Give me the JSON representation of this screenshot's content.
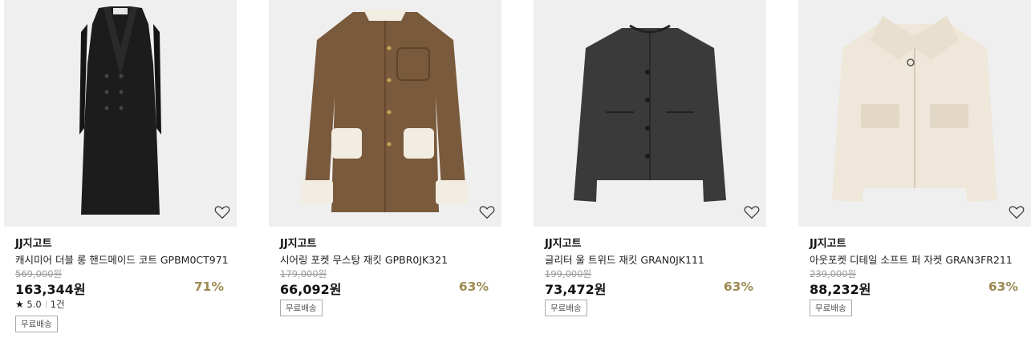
{
  "products": [
    {
      "brand": "JJ지고트",
      "name": "캐시미어 더블 롱 핸드메이드 코트 GPBM0CT971",
      "original_price": "569,000원",
      "price": "163,344원",
      "discount": "71%",
      "rating": "5.0",
      "review_count": "1건",
      "badge": "무료배송",
      "wishlist_icon": "heart-outline-icon",
      "image_colors": {
        "garment": "#1c1c1c",
        "trim": "#111111"
      }
    },
    {
      "brand": "JJ지고트",
      "name": "시어링 포켓 무스탕 재킷 GPBR0JK321",
      "original_price": "179,000원",
      "price": "66,092원",
      "discount": "63%",
      "badge": "무료배송",
      "wishlist_icon": "heart-outline-icon",
      "image_colors": {
        "garment": "#7a5a3c",
        "trim": "#f2ede2"
      }
    },
    {
      "brand": "JJ지고트",
      "name": "글리터 울 트위드 재킷 GRAN0JK111",
      "original_price": "199,000원",
      "price": "73,472원",
      "discount": "63%",
      "badge": "무료배송",
      "wishlist_icon": "heart-outline-icon",
      "image_colors": {
        "garment": "#3a3a3a",
        "trim": "#2a2a2a"
      }
    },
    {
      "brand": "JJ지고트",
      "name": "아웃포켓 디테일 소프트 퍼 자켓 GRAN3FR211",
      "original_price": "239,000원",
      "price": "88,232원",
      "discount": "63%",
      "badge": "무료배송",
      "wishlist_icon": "heart-outline-icon",
      "image_colors": {
        "garment": "#efe7da",
        "trim": "#e3d8c6"
      }
    }
  ],
  "colors": {
    "discount": "#9d8a54",
    "image_bg": "#efefef",
    "strike": "#999999"
  }
}
